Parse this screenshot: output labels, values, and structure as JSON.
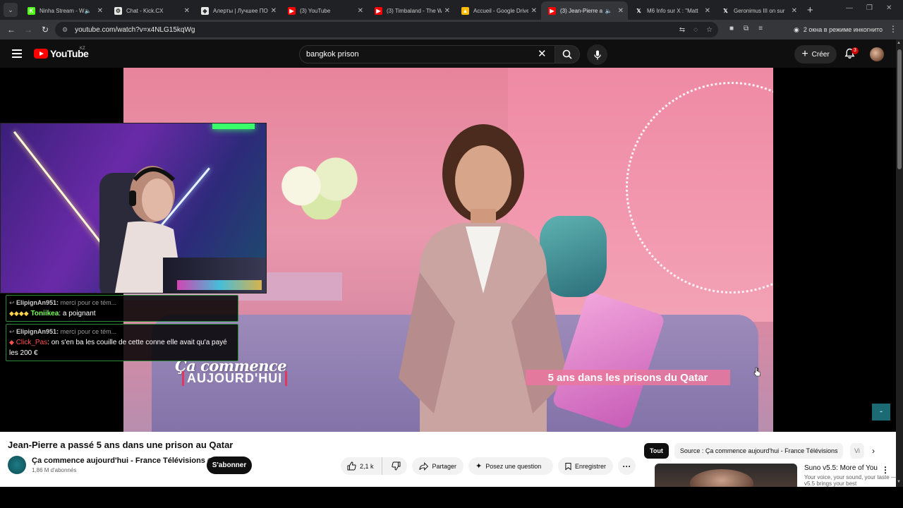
{
  "browser": {
    "tabs": [
      {
        "title": "Ninha Stream - W",
        "color": "#53fc18",
        "glyph": "K"
      },
      {
        "title": "Chat - Kick.CX",
        "color": "#e8e8e8",
        "glyph": "⚙"
      },
      {
        "title": "Алерты | Лучшее ПО",
        "color": "#e8e8e8",
        "glyph": "◆"
      },
      {
        "title": "(3) YouTube",
        "color": "#ff0000",
        "glyph": "▶"
      },
      {
        "title": "(3) Timbaland - The W",
        "color": "#ff0000",
        "glyph": "▶"
      },
      {
        "title": "Accueil - Google Drive",
        "color": "#fbbc04",
        "glyph": "▲"
      },
      {
        "title": "(3) Jean-Pierre a",
        "color": "#ff0000",
        "glyph": "▶"
      },
      {
        "title": "M6 Info sur X : \"Matt",
        "color": "#202124",
        "glyph": "𝕏"
      },
      {
        "title": "Geronimus III on sur",
        "color": "#202124",
        "glyph": "𝕏"
      }
    ],
    "active_tab_index": 6,
    "address": "youtube.com/watch?v=x4NLG15kqWg",
    "incognito_label": "2 окна в режиме инкогнито"
  },
  "youtube": {
    "logo_text": "YouTube",
    "country_code": "KZ",
    "search_value": "bangkok prison",
    "create_label": "Créer",
    "notification_count": "3"
  },
  "overlay": {
    "chat": [
      {
        "reply_user": "ElipignAn951:",
        "reply_text": "merci pour ce tém...",
        "user": "Toniikea",
        "text": ": a poignant",
        "user_color": "green"
      },
      {
        "reply_user": "ElipignAn951:",
        "reply_text": "merci pour ce tém...",
        "user": "Click_Pas",
        "text": ": on s'en ba les couille de cette conne elle avait qu'a payé les 200 €",
        "user_color": "red"
      }
    ]
  },
  "video": {
    "show_logo_line1": "Ça commence",
    "show_logo_line2": "AUJOURD'HUI",
    "caption": "5 ans dans les prisons du Qatar",
    "title": "Jean-Pierre a passé 5 ans dans une prison au Qatar",
    "channel": "Ça commence aujourd'hui - France Télévisions",
    "subscribers": "1,86 M d'abonnés",
    "subscribe_label": "S'abonner",
    "likes": "2,1 k",
    "share_label": "Partager",
    "ask_label": "Posez une question",
    "save_label": "Enregistrer"
  },
  "sidebar": {
    "chips": [
      "Tout",
      "Source : Ça commence aujourd'hui - France Télévisions",
      "Vi"
    ],
    "rec_title": "Suno v5.5: More of You",
    "rec_sub": "Your voice, your sound, your taste — v5.5 brings your best"
  }
}
